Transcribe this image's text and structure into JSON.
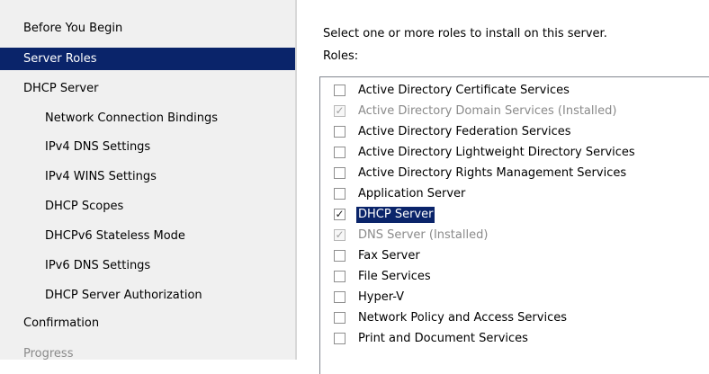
{
  "nav": {
    "items": [
      {
        "label": "Before You Begin",
        "state": "normal",
        "level": "top"
      },
      {
        "label": "Server Roles",
        "state": "selected",
        "level": "top"
      },
      {
        "label": "DHCP Server",
        "state": "normal",
        "level": "top"
      },
      {
        "label": "Network Connection Bindings",
        "state": "normal",
        "level": "sub"
      },
      {
        "label": "IPv4 DNS Settings",
        "state": "normal",
        "level": "sub"
      },
      {
        "label": "IPv4 WINS Settings",
        "state": "normal",
        "level": "sub"
      },
      {
        "label": "DHCP Scopes",
        "state": "normal",
        "level": "sub"
      },
      {
        "label": "DHCPv6 Stateless Mode",
        "state": "normal",
        "level": "sub"
      },
      {
        "label": "IPv6 DNS Settings",
        "state": "normal",
        "level": "sub"
      },
      {
        "label": "DHCP Server Authorization",
        "state": "normal",
        "level": "sub"
      },
      {
        "label": "Confirmation",
        "state": "normal",
        "level": "top"
      },
      {
        "label": "Progress",
        "state": "disabled",
        "level": "top"
      }
    ]
  },
  "content": {
    "instruction": "Select one or more roles to install on this server.",
    "roles_label": "Roles:"
  },
  "roles": [
    {
      "label": "Active Directory Certificate Services",
      "checked": false,
      "disabled": false
    },
    {
      "label": "Active Directory Domain Services  (Installed)",
      "checked": true,
      "disabled": true
    },
    {
      "label": "Active Directory Federation Services",
      "checked": false,
      "disabled": false
    },
    {
      "label": "Active Directory Lightweight Directory Services",
      "checked": false,
      "disabled": false
    },
    {
      "label": "Active Directory Rights Management Services",
      "checked": false,
      "disabled": false
    },
    {
      "label": "Application Server",
      "checked": false,
      "disabled": false
    },
    {
      "label": "DHCP Server",
      "checked": true,
      "disabled": false,
      "highlighted": true
    },
    {
      "label": "DNS Server  (Installed)",
      "checked": true,
      "disabled": true
    },
    {
      "label": "Fax Server",
      "checked": false,
      "disabled": false
    },
    {
      "label": "File Services",
      "checked": false,
      "disabled": false
    },
    {
      "label": "Hyper-V",
      "checked": false,
      "disabled": false
    },
    {
      "label": "Network Policy and Access Services",
      "checked": false,
      "disabled": false
    },
    {
      "label": "Print and Document Services",
      "checked": false,
      "disabled": false
    }
  ],
  "colors": {
    "selection": "#0a246a",
    "nav_background": "#f0f0f0",
    "disabled_text": "#8a8a8a"
  },
  "icons": {
    "checkmark": "checkmark-icon"
  }
}
